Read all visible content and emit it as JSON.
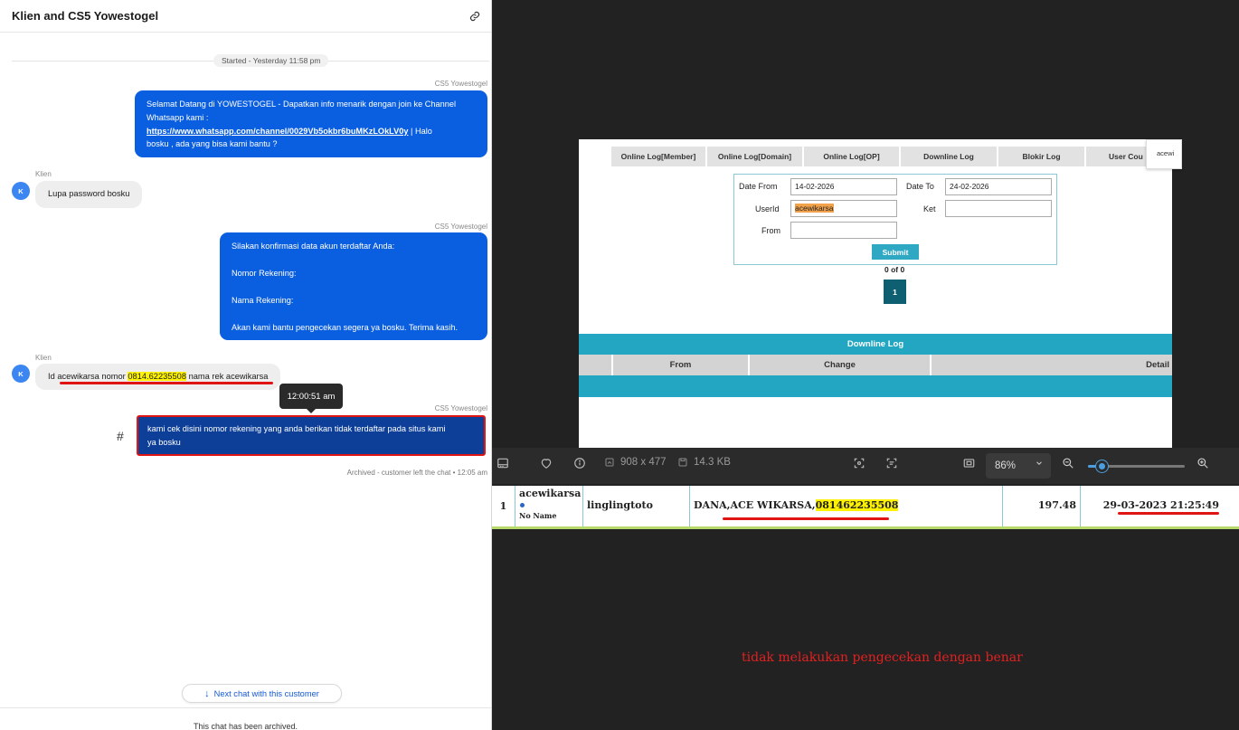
{
  "chat": {
    "title": "Klien and CS5 Yowestogel",
    "started": "Started - Yesterday 11:58 pm",
    "messages": [
      {
        "sender": "CS5 Yowestogel",
        "line1": "Selamat Datang di YOWESTOGEL - Dapatkan info menarik dengan join ke Channel",
        "line2": "Whatsapp kami :",
        "link": "https://www.whatsapp.com/channel/0029Vb5okbr6buMKzLOkLV0y",
        "after_link": " | Halo",
        "line4": "bosku , ada yang bisa kami bantu ?"
      },
      {
        "sender": "Klien",
        "avatar": "K",
        "text": "Lupa password bosku"
      },
      {
        "sender": "CS5 Yowestogel",
        "lines": [
          "Silakan konfirmasi data akun terdaftar Anda:",
          "Nomor Rekening:",
          "Nama Rekening:",
          "Akan kami bantu pengecekan segera ya bosku. Terima kasih."
        ]
      },
      {
        "sender": "Klien",
        "avatar": "K",
        "pre": "Id acewikarsa nomor ",
        "highlight": "0814.62235508",
        "post": " nama rek acewikarsa"
      },
      {
        "sender": "CS5 Yowestogel",
        "line1": "kami cek disini nomor rekening yang anda berikan tidak terdaftar pada situs kami",
        "line2": "ya bosku"
      }
    ],
    "tooltip": "12:00:51 am",
    "hash": "#",
    "archived_note": "Archived - customer left the chat • 12:05 am",
    "next_chat": "Next chat with this customer",
    "footer": "This chat has been archived."
  },
  "doc": {
    "tabs": [
      "Online Log[Member]",
      "Online Log[Domain]",
      "Online Log[OP]",
      "Downline Log",
      "Blokir Log",
      "User Cou"
    ],
    "corner": "acewi",
    "form": {
      "date_from_label": "Date From",
      "date_from": "14-02-2026",
      "date_to_label": "Date To",
      "date_to": "24-02-2026",
      "userid_label": "UserId",
      "userid": "acewikarsa",
      "ket_label": "Ket",
      "ket": "",
      "from_label": "From",
      "from": "",
      "submit": "Submit"
    },
    "count": "0 of 0",
    "page": "1",
    "downline_title": "Downline Log",
    "columns": [
      "From",
      "Change",
      "Detail"
    ]
  },
  "toolbar": {
    "dimensions": "908 x 477",
    "filesize": "14.3 KB",
    "zoom": "86%",
    "zoom_level": 0.15
  },
  "strip": {
    "row": "1",
    "username": "acewikarsa",
    "noname": "No Name",
    "referral": "linglingtoto",
    "change_pre": "DANA,ACE WIKARSA,",
    "change_hl": "081462235508",
    "amount": "197.48",
    "datetime": "29-03-2023 21:25:49"
  },
  "note": "tidak melakukan pengecekan dengan benar",
  "colors": {
    "agent_bubble": "#0a5ee0",
    "highlight": "#fff200",
    "teal": "#22a6c2",
    "alert": "#e11414"
  }
}
